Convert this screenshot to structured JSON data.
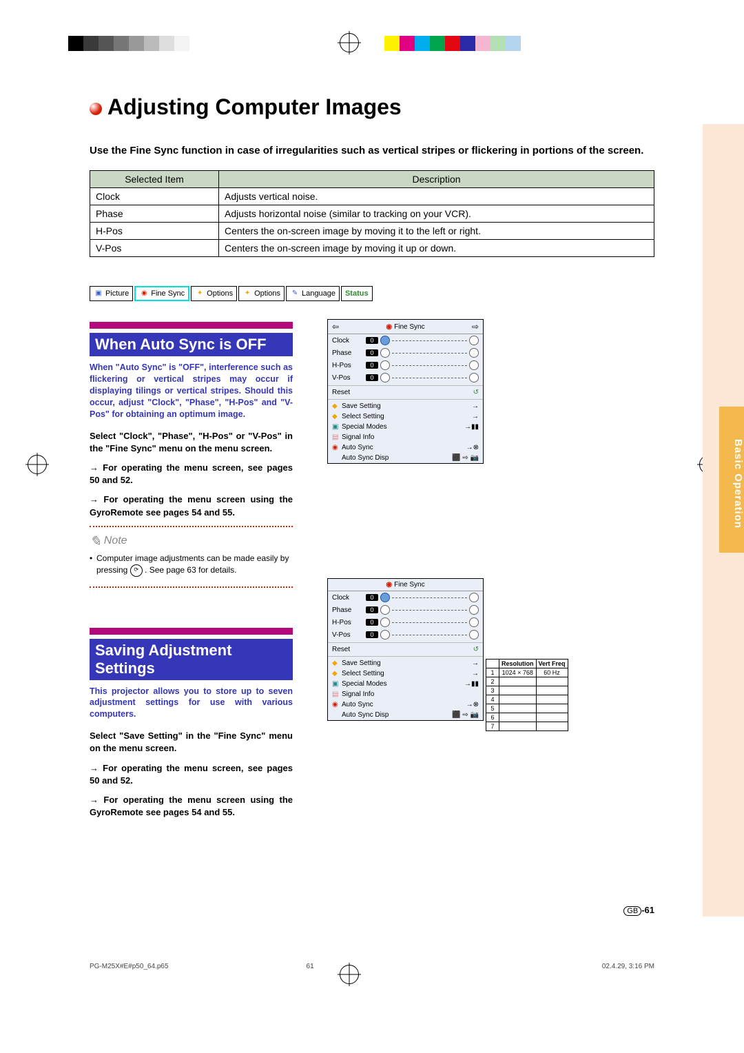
{
  "page_title": "Adjusting Computer Images",
  "intro": "Use the Fine Sync function in case of irregularities such as vertical stripes or flickering in portions of the screen.",
  "table": {
    "headers": [
      "Selected Item",
      "Description"
    ],
    "rows": [
      [
        "Clock",
        "Adjusts vertical noise."
      ],
      [
        "Phase",
        "Adjusts horizontal noise (similar to tracking on your VCR)."
      ],
      [
        "H-Pos",
        "Centers the on-screen image by moving it to the left or right."
      ],
      [
        "V-Pos",
        "Centers the on-screen image by moving it up or down."
      ]
    ]
  },
  "menu_tabs": [
    {
      "label": "Picture",
      "active": false,
      "icon_color": "#3a5fd8"
    },
    {
      "label": "Fine Sync",
      "active": true,
      "icon_color": "#d81e05"
    },
    {
      "label": "Options",
      "active": false,
      "icon_color": "#f5a300"
    },
    {
      "label": "Options",
      "active": false,
      "icon_color": "#f5a300"
    },
    {
      "label": "Language",
      "active": false,
      "icon_color": "#3a5fd8"
    },
    {
      "label": "Status",
      "active": false,
      "icon_color": "#2d8a2d",
      "text_only": true
    }
  ],
  "section1": {
    "heading": "When Auto Sync is OFF",
    "blue_para": "When \"Auto Sync\" is \"OFF\", interference such as flickering or vertical stripes may occur if displaying tilings or vertical stripes. Should this occur, adjust \"Clock\", \"Phase\", \"H-Pos\" and \"V-Pos\" for obtaining an optimum image.",
    "p1": "Select \"Clock\", \"Phase\", \"H-Pos\" or \"V-Pos\" in the \"Fine Sync\" menu on the menu screen.",
    "p2": "For operating the menu screen, see pages 50 and 52.",
    "p3": "For operating the menu screen using the GyroRemote see pages 54 and 55."
  },
  "note": {
    "label": "Note",
    "body_pre": "Computer image adjustments can be made easily by pressing ",
    "body_post": ". See page 63 for details.",
    "btn_label": "AUTO SYNC"
  },
  "section2": {
    "heading": "Saving Adjustment Settings",
    "blue_para": "This projector allows you to store up to seven adjustment settings for use with various computers.",
    "p1": "Select \"Save Setting\" in the \"Fine Sync\" menu on the menu screen.",
    "p2": "For operating the menu screen, see pages 50 and 52.",
    "p3": "For operating the menu screen using the GyroRemote see pages 54 and 55."
  },
  "fine_sync_menu": {
    "title": "Fine Sync",
    "sliders": [
      {
        "label": "Clock",
        "value": "0",
        "selected": true
      },
      {
        "label": "Phase",
        "value": "0",
        "selected": false
      },
      {
        "label": "H-Pos",
        "value": "0",
        "selected": false
      },
      {
        "label": "V-Pos",
        "value": "0",
        "selected": false
      }
    ],
    "reset_label": "Reset",
    "options": [
      {
        "label": "Save Setting",
        "end": "→"
      },
      {
        "label": "Select Setting",
        "end": "→"
      },
      {
        "label": "Special Modes",
        "end": "→▮▮"
      },
      {
        "label": "Signal Info",
        "end": ""
      },
      {
        "label": "Auto Sync",
        "end": "→⊗"
      },
      {
        "label": "Auto Sync Disp",
        "end": "⬛ ⇨ 📷"
      }
    ]
  },
  "resolution_table": {
    "headers": [
      "",
      "Resolution",
      "Vert Freq"
    ],
    "row1": [
      "1",
      "1024 × 768",
      "60 Hz"
    ],
    "numbers": [
      "2",
      "3",
      "4",
      "5",
      "6",
      "7"
    ]
  },
  "side_tab": "Basic Operation",
  "page_number": "-61",
  "page_region": "GB",
  "footer": {
    "left": "PG-M25X#E#p50_64.p65",
    "mid": "61",
    "right": "02.4.29, 3:16 PM"
  }
}
